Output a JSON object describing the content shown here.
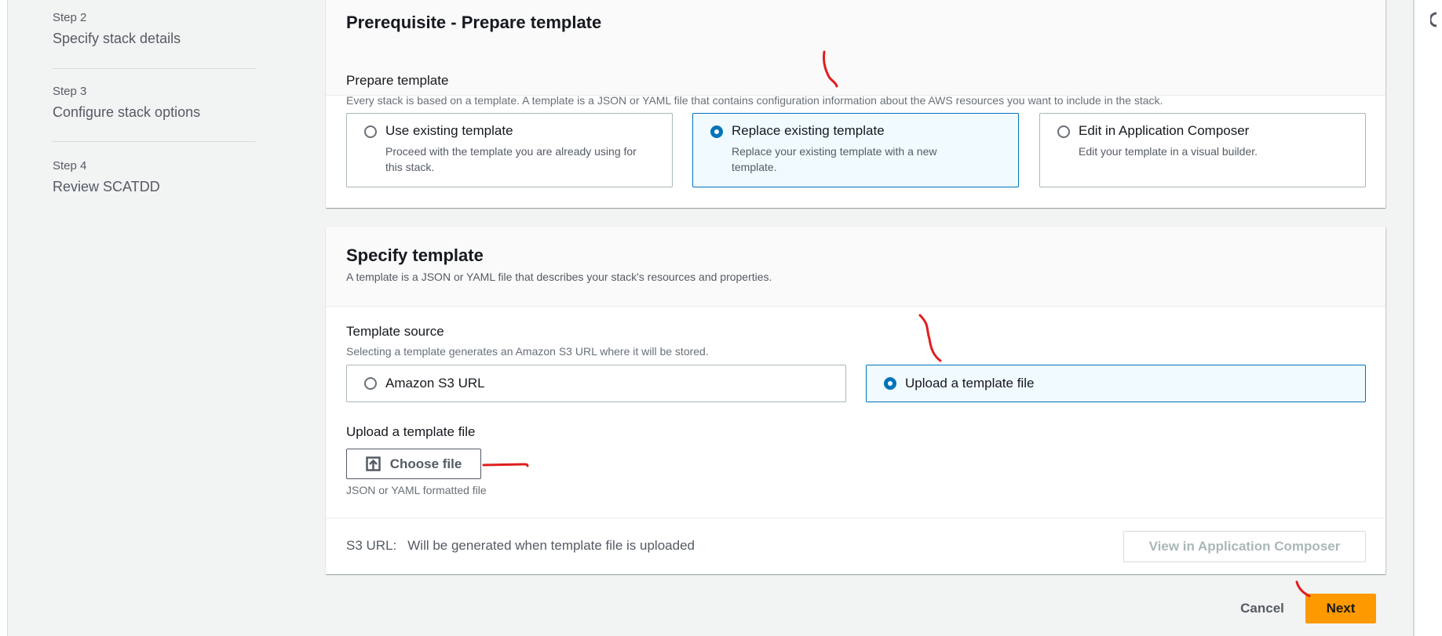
{
  "sidebar": {
    "steps": [
      {
        "number": "Step 2",
        "title": "Specify stack details"
      },
      {
        "number": "Step 3",
        "title": "Configure stack options"
      },
      {
        "number": "Step 4",
        "title": "Review SCATDD"
      }
    ]
  },
  "prerequisite": {
    "heading": "Prerequisite - Prepare template",
    "label": "Prepare template",
    "description": "Every stack is based on a template. A template is a JSON or YAML file that contains configuration information about the AWS resources you want to include in the stack.",
    "options": [
      {
        "title": "Use existing template",
        "description": "Proceed with the template you are already using for this stack.",
        "selected": false
      },
      {
        "title": "Replace existing template",
        "description": "Replace your existing template with a new template.",
        "selected": true
      },
      {
        "title": "Edit in Application Composer",
        "description": "Edit your template in a visual builder.",
        "selected": false
      }
    ]
  },
  "specify": {
    "heading": "Specify template",
    "description": "A template is a JSON or YAML file that describes your stack's resources and properties.",
    "source_label": "Template source",
    "source_hint": "Selecting a template generates an Amazon S3 URL where it will be stored.",
    "sources": [
      {
        "title": "Amazon S3 URL",
        "selected": false
      },
      {
        "title": "Upload a template file",
        "selected": true
      }
    ],
    "upload_label": "Upload a template file",
    "choose_file": "Choose file",
    "upload_hint": "JSON or YAML formatted file",
    "s3_url_label": "S3 URL:",
    "s3_url_value": "Will be generated when template file is uploaded",
    "view_composer": "View in Application Composer"
  },
  "footer": {
    "cancel": "Cancel",
    "next": "Next"
  },
  "colors": {
    "primary": "#ec7211",
    "selected": "#0073bb",
    "annotation": "#e01e1e"
  }
}
